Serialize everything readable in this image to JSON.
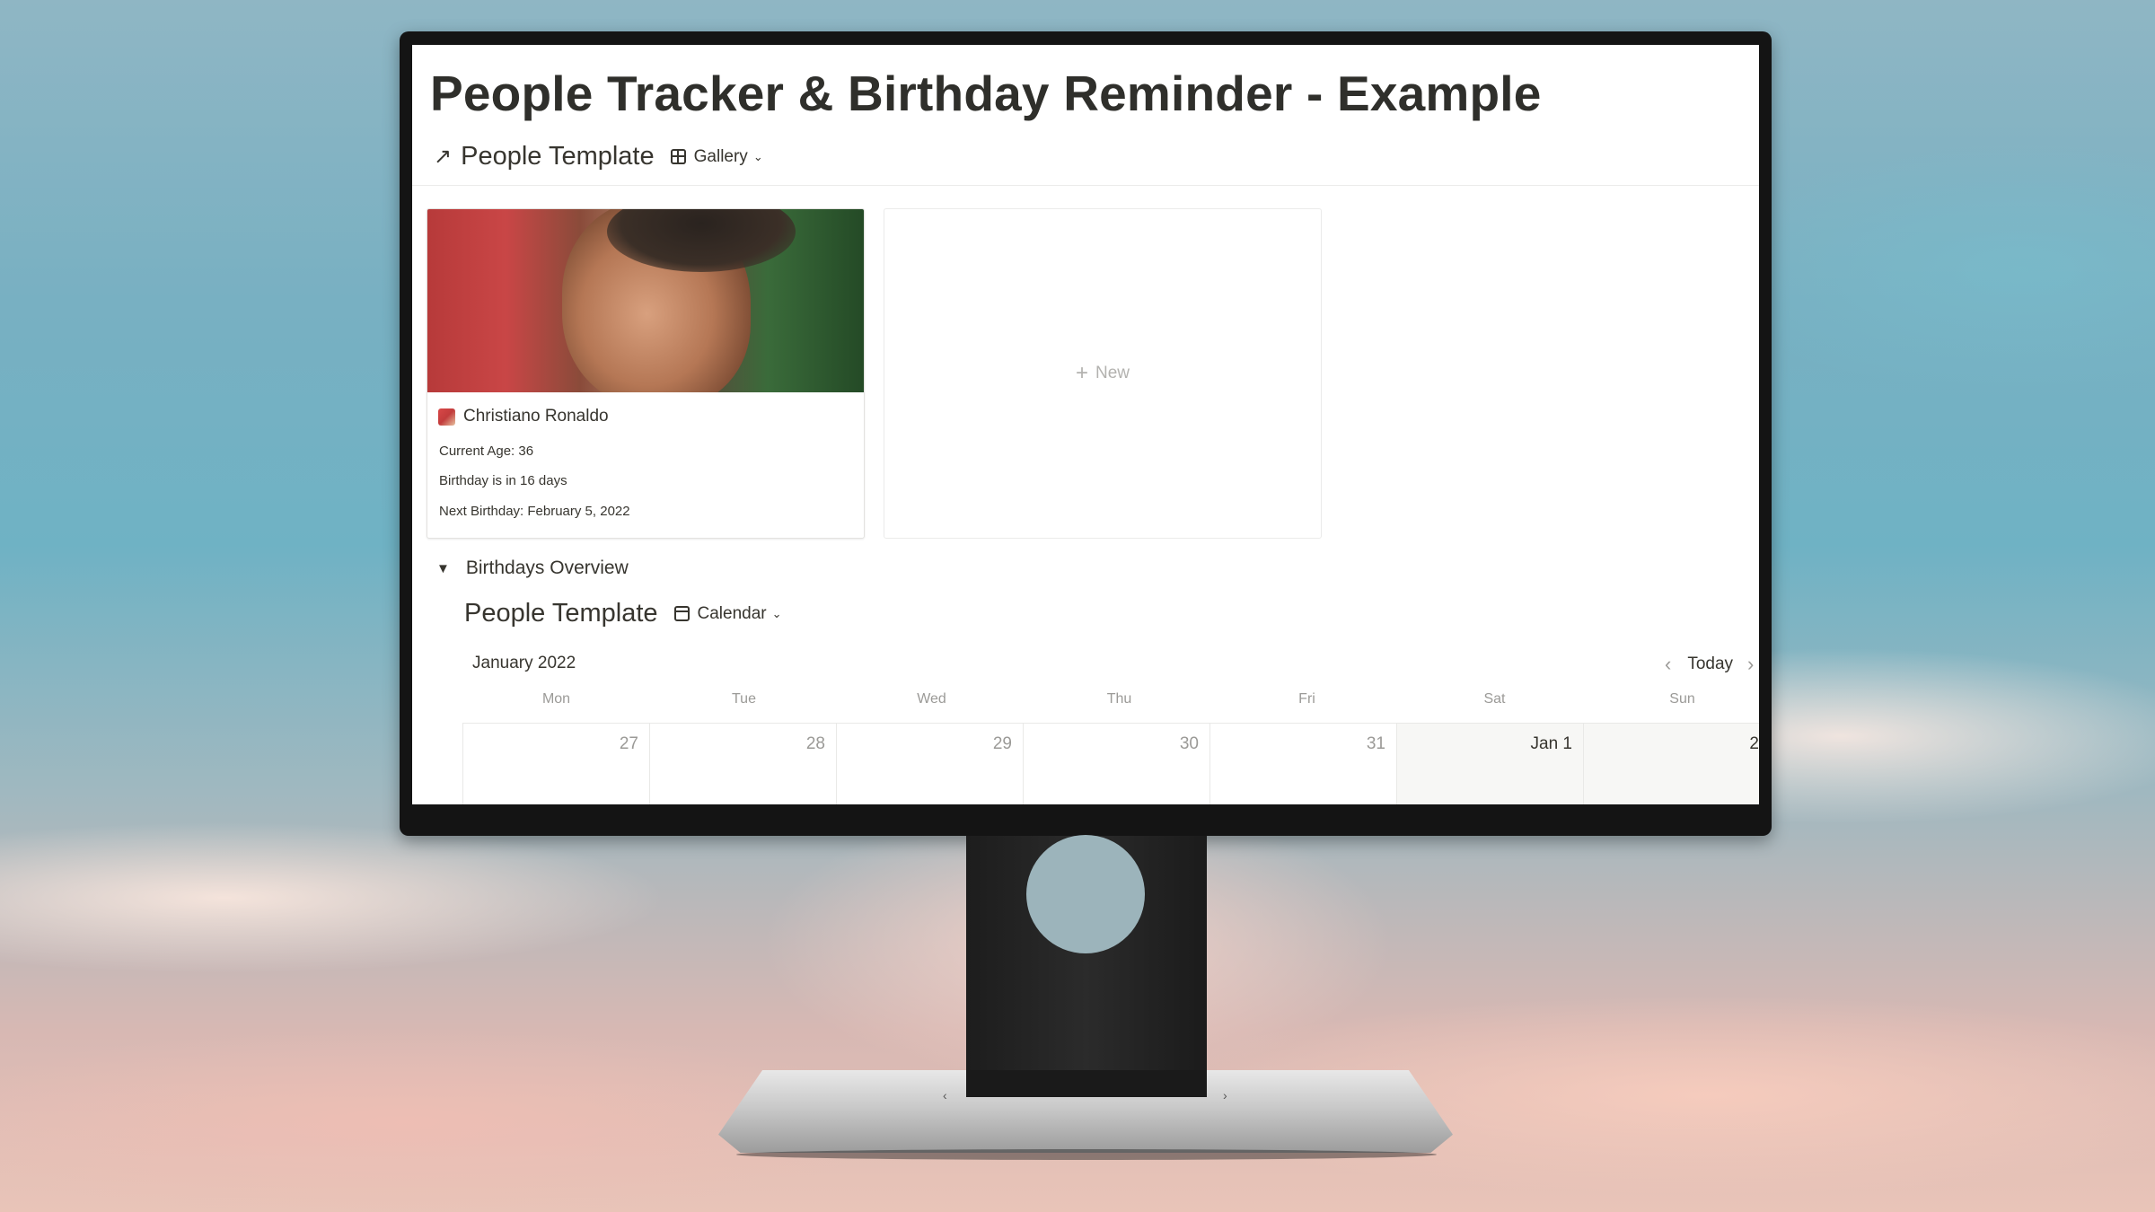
{
  "page": {
    "title": "People Tracker & Birthday Reminder - Example"
  },
  "gallery_view": {
    "link_icon": "arrow-up-right-icon",
    "db_title": "People Template",
    "view_type": "Gallery",
    "cards": [
      {
        "name": "Christiano Ronaldo",
        "icon": "person-photo-icon",
        "properties": [
          "Current Age: 36",
          "Birthday is in 16 days",
          "Next Birthday: February 5, 2022"
        ]
      }
    ],
    "new_label": "New"
  },
  "toggle": {
    "label": "Birthdays Overview",
    "expanded": true
  },
  "calendar_view": {
    "db_title": "People Template",
    "view_type": "Calendar",
    "month_label": "January 2022",
    "today_label": "Today",
    "weekdays": [
      "Mon",
      "Tue",
      "Wed",
      "Thu",
      "Fri",
      "Sat",
      "Sun"
    ],
    "first_week": [
      "27",
      "28",
      "29",
      "30",
      "31",
      "Jan 1",
      "2"
    ]
  },
  "colors": {
    "text": "#37352f",
    "muted": "#9b9a97",
    "weekend_bg": "#f7f7f5",
    "monitor_bezel": "#141414"
  }
}
